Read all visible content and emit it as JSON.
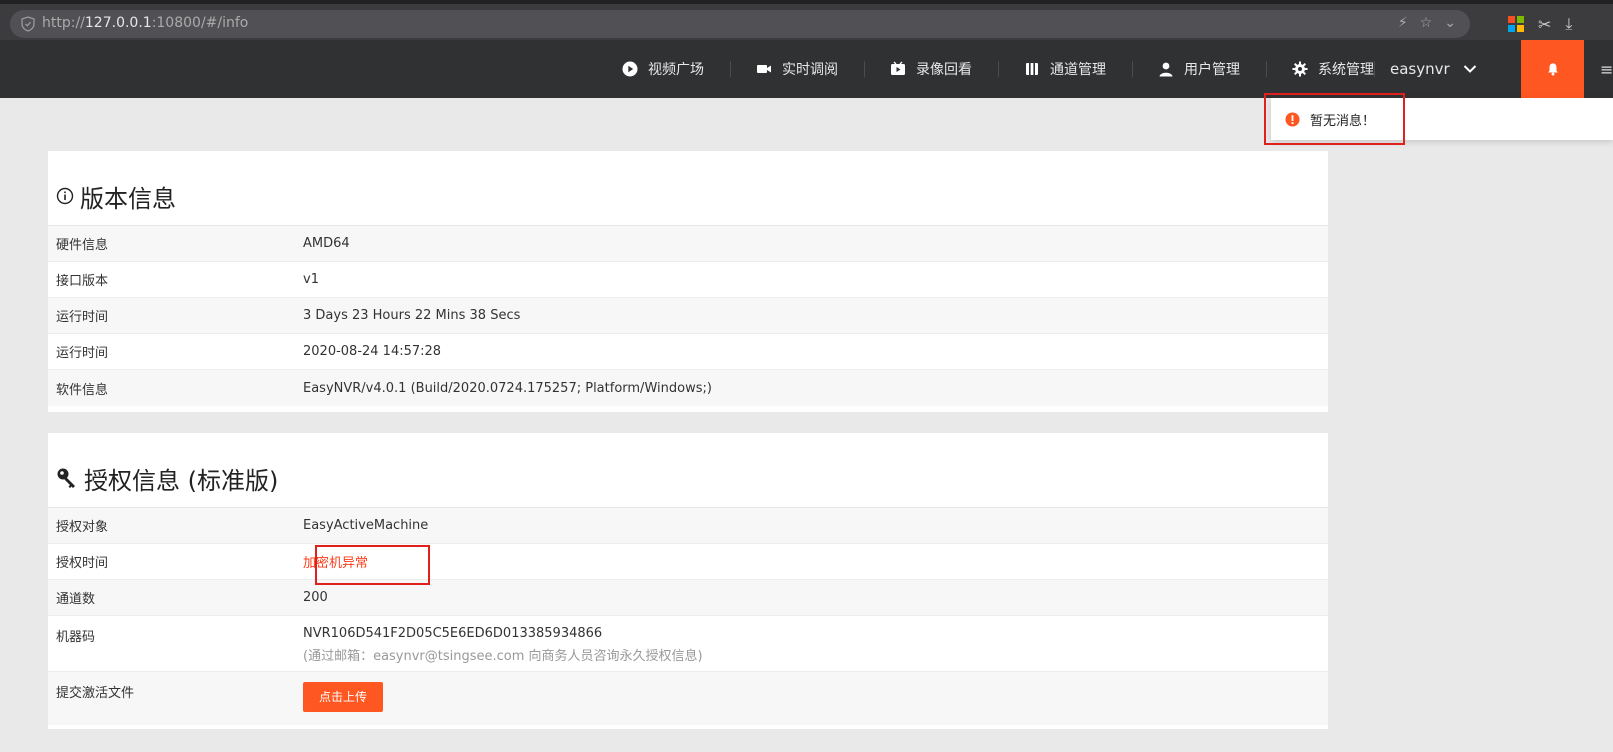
{
  "browser": {
    "url_prefix": "http://",
    "url_host": "127.0.0.1",
    "url_suffix": ":10800/#/info"
  },
  "nav": {
    "items": [
      {
        "label": "视频广场",
        "icon": "play-circle-icon"
      },
      {
        "label": "实时调阅",
        "icon": "video-camera-icon"
      },
      {
        "label": "录像回看",
        "icon": "playback-icon"
      },
      {
        "label": "通道管理",
        "icon": "channel-icon"
      },
      {
        "label": "用户管理",
        "icon": "user-icon"
      },
      {
        "label": "系统管理",
        "icon": "gear-icon"
      }
    ],
    "user": "easynvr"
  },
  "notification": {
    "text": "暂无消息！"
  },
  "version_panel": {
    "title": "版本信息",
    "rows": [
      {
        "key": "硬件信息",
        "value": "AMD64"
      },
      {
        "key": "接口版本",
        "value": "v1"
      },
      {
        "key": "运行时间",
        "value": "3 Days 23 Hours 22 Mins 38 Secs"
      },
      {
        "key": "运行时间",
        "value": "2020-08-24 14:57:28"
      },
      {
        "key": "软件信息",
        "value": "EasyNVR/v4.0.1 (Build/2020.0724.175257; Platform/Windows;)"
      }
    ]
  },
  "license_panel": {
    "title": "授权信息 (标准版)",
    "object_key": "授权对象",
    "object_value": "EasyActiveMachine",
    "time_key": "授权时间",
    "time_value": "加密机异常",
    "channels_key": "通道数",
    "channels_value": "200",
    "machine_key": "机器码",
    "machine_value": "NVR106D541F2D05C5E6ED6D013385934866",
    "machine_note": "(通过邮箱：easynvr@tsingsee.com 向商务人员咨询永久授权信息)",
    "upload_key": "提交激活文件",
    "upload_button": "点击上传"
  },
  "colors": {
    "accent": "#ff5722",
    "nav_bg": "#2f3133",
    "warning_text": "#ff3d1a",
    "highlight_box": "#e0201c"
  }
}
